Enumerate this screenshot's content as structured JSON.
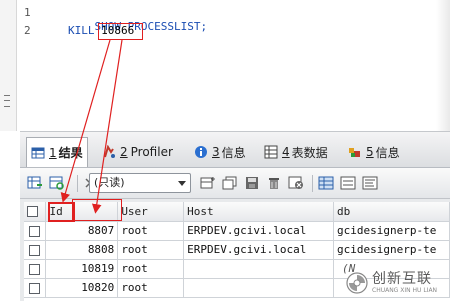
{
  "editor": {
    "lines": [
      {
        "number": "1",
        "keyword": "SHOW PROCESSLIST;",
        "value": ""
      },
      {
        "number": "2",
        "keyword": "KILL ",
        "value": "10866"
      }
    ]
  },
  "tabs": [
    {
      "number": "1",
      "label": "结果",
      "icon": "grid-icon",
      "active": true
    },
    {
      "number": "2",
      "label": "Profiler",
      "icon": "profiler-icon",
      "active": false
    },
    {
      "number": "3",
      "label": "信息",
      "icon": "info-icon",
      "active": false
    },
    {
      "number": "4",
      "label": "表数据",
      "icon": "table-data-icon",
      "active": false
    },
    {
      "number": "5",
      "label": "信息",
      "icon": "info-colored-icon",
      "active": false
    }
  ],
  "toolbar": {
    "mode_select": "(只读)"
  },
  "grid": {
    "columns": [
      "Id",
      "User",
      "Host",
      "db"
    ],
    "rows": [
      {
        "id": "8807",
        "user": "root",
        "host": "ERPDEV.gcivi.local",
        "db": "gcidesignerp-te"
      },
      {
        "id": "8808",
        "user": "root",
        "host": "ERPDEV.gcivi.local",
        "db": "gcidesignerp-te"
      },
      {
        "id": "10819",
        "user": "root",
        "host": "",
        "db": "(N"
      },
      {
        "id": "10820",
        "user": "root",
        "host": "",
        "db": ""
      }
    ]
  },
  "colors": {
    "annotation_red": "#e02020",
    "keyword_blue": "#1a4db2"
  },
  "watermark": {
    "main": "创新互联",
    "sub": "CHUANG XIN HU LIAN"
  }
}
